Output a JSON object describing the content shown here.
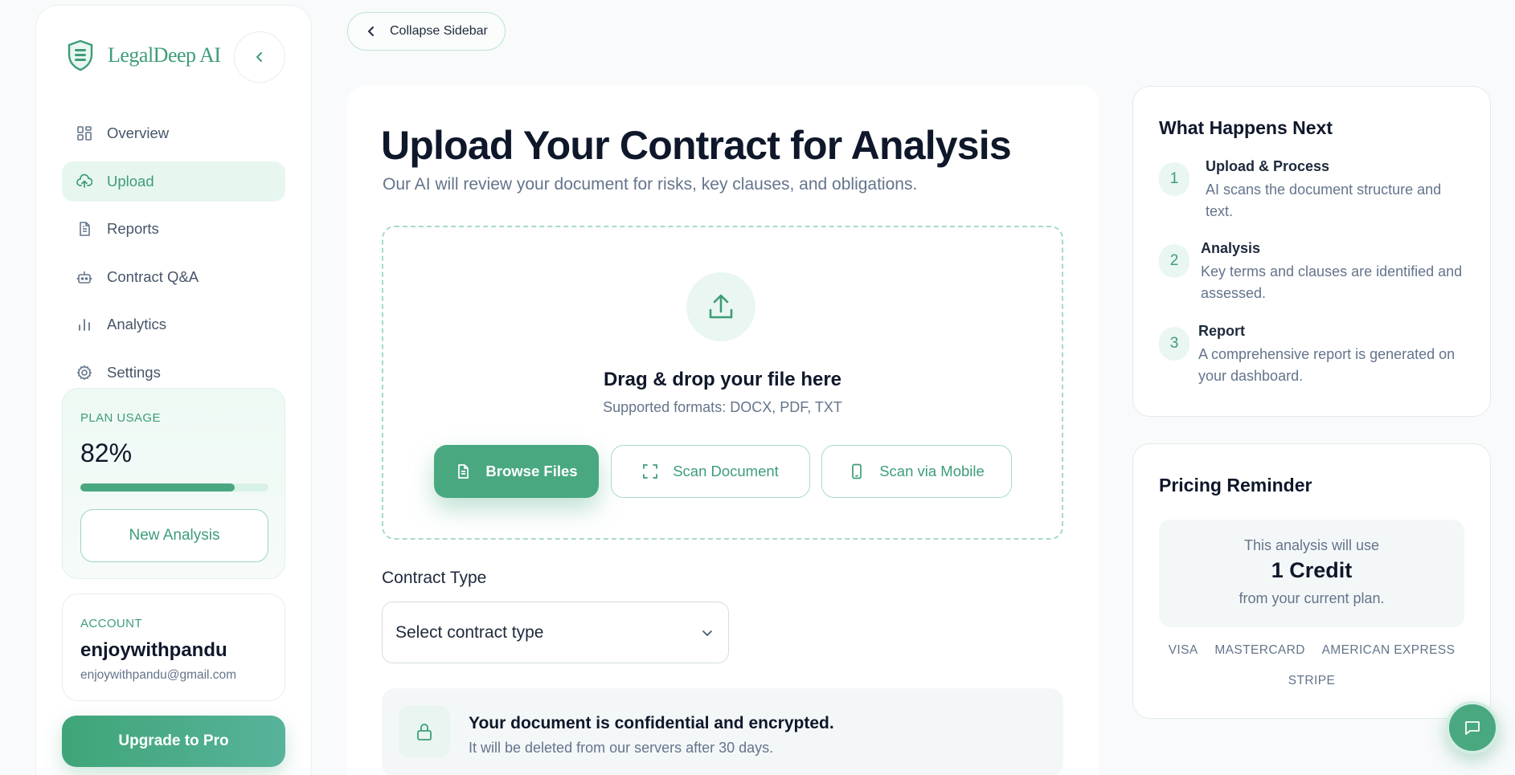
{
  "brand": {
    "name": "LegalDeep AI"
  },
  "top": {
    "collapse_label": "Collapse Sidebar"
  },
  "sidebar": {
    "items": [
      {
        "label": "Overview",
        "icon": "grid-icon"
      },
      {
        "label": "Upload",
        "icon": "cloud-upload-icon",
        "active": true
      },
      {
        "label": "Reports",
        "icon": "document-icon"
      },
      {
        "label": "Contract Q&A",
        "icon": "robot-icon"
      },
      {
        "label": "Analytics",
        "icon": "bar-chart-icon"
      },
      {
        "label": "Settings",
        "icon": "gear-icon"
      }
    ],
    "plan": {
      "label": "PLAN USAGE",
      "percent_text": "82%",
      "percent": 82,
      "button": "New Analysis"
    },
    "account": {
      "label": "ACCOUNT",
      "name": "enjoywithpandu",
      "email": "enjoywithpandu@gmail.com"
    },
    "upgrade": "Upgrade to Pro"
  },
  "main": {
    "title": "Upload Your Contract for Analysis",
    "subtitle": "Our AI will review your document for risks, key clauses, and obligations.",
    "dropzone": {
      "title": "Drag & drop your file here",
      "formats": "Supported formats: DOCX, PDF, TXT",
      "browse": "Browse Files",
      "scan": "Scan Document",
      "mobile": "Scan via Mobile"
    },
    "contract_type": {
      "label": "Contract Type",
      "placeholder": "Select contract type"
    },
    "secure": {
      "title": "Your document is confidential and encrypted.",
      "subtitle": "It will be deleted from our servers after 30 days."
    }
  },
  "next": {
    "title": "What Happens Next",
    "steps": [
      {
        "num": "1",
        "title": "Upload & Process",
        "desc": "AI scans the document structure and text."
      },
      {
        "num": "2",
        "title": "Analysis",
        "desc": "Key terms and clauses are identified and assessed."
      },
      {
        "num": "3",
        "title": "Report",
        "desc": "A comprehensive report is generated on your dashboard."
      }
    ]
  },
  "pricing": {
    "title": "Pricing Reminder",
    "line1": "This analysis will use",
    "credit": "1 Credit",
    "line2": "from your current plan.",
    "methods": [
      "VISA",
      "MASTERCARD",
      "AMERICAN EXPRESS",
      "STRIPE"
    ]
  },
  "colors": {
    "accent": "#49a880",
    "accent_text": "#3d9d77",
    "accent_light": "#e9f6f1"
  }
}
